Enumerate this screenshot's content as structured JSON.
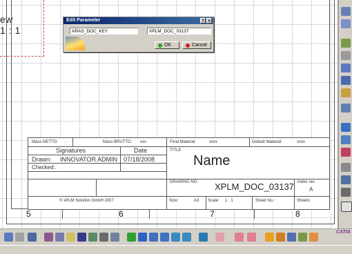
{
  "view": {
    "label_line1": "ew",
    "label_line2": "1 : 1"
  },
  "dialog": {
    "title": "Edit Parameter",
    "help_btn": "?",
    "close_btn": "×",
    "param_name": "ARAS_DOC_KEY",
    "param_value": "XPLM_DOC_03137",
    "ok_label": "OK",
    "cancel_label": "Cancel"
  },
  "title_block": {
    "mass_netto_label": "Mass NETTO:",
    "mass_netto_value": ".",
    "mass_brutto_label": "Mass BRUTTO:",
    "mass_brutto_value": "xxx",
    "final_material_label": "Final Material:",
    "final_material_value": "xxxx",
    "default_material_label": "Default Material:",
    "default_material_value": "xxxx",
    "signatures_header": "Signatures",
    "date_header": "Date",
    "title_label": "TITLE",
    "drawn_label": "Drawn:",
    "drawn_by": "INNOVATOR ADMIN",
    "drawn_date": "07/18/2008",
    "name_value": "Name",
    "checked_label": "Checked:.",
    "checked_date": ".",
    "drawing_no_label": "DRAWING NO.",
    "drawing_no_value": "XPLM_DOC_03137",
    "index_rev_label": "Index rev.",
    "index_rev_value": "A",
    "copyright": "© xPLM Solution GmbH 2007",
    "size_label": "Size:",
    "size_value": "A3",
    "scale_label": "Scale:",
    "scale_value": "1 : 1",
    "sheet_no_label": "Sheet No.:",
    "sheets_label": "Sheets:"
  },
  "zones": [
    "5",
    "6",
    "7",
    "8"
  ],
  "branding": {
    "catia": "CATIA"
  },
  "colors": {
    "title_bar": "#0a246a",
    "ok_dot": "#2aa02a",
    "cancel_dot": "#d02020",
    "dashed_frame": "#d04040"
  },
  "right_toolbar_icons": [
    "select-arrow-icon",
    "sketch-icon",
    "view-icon",
    "grid-icon",
    "dimension-icon",
    "annotation-icon",
    "table-icon",
    "cursor-icon",
    "frame-icon",
    "detail-icon",
    "section-icon",
    "text-icon",
    "axis-icon",
    "symbol-icon"
  ],
  "bottom_toolbar_icons": [
    "undo-icon",
    "redo-icon",
    "help-pointer-icon",
    "formula-icon",
    "knowledge-icon",
    "light-icon",
    "table-icon",
    "graph-icon",
    "param-icon",
    "update-icon",
    "fit-all-icon",
    "pan-icon",
    "zoom-in-icon",
    "zoom-out-icon",
    "normal-view-icon",
    "sheet-icon",
    "swap-icon",
    "grid-icon",
    "snap-icon",
    "layout-icon",
    "analysis-icon",
    "dress-icon",
    "image-icon"
  ]
}
